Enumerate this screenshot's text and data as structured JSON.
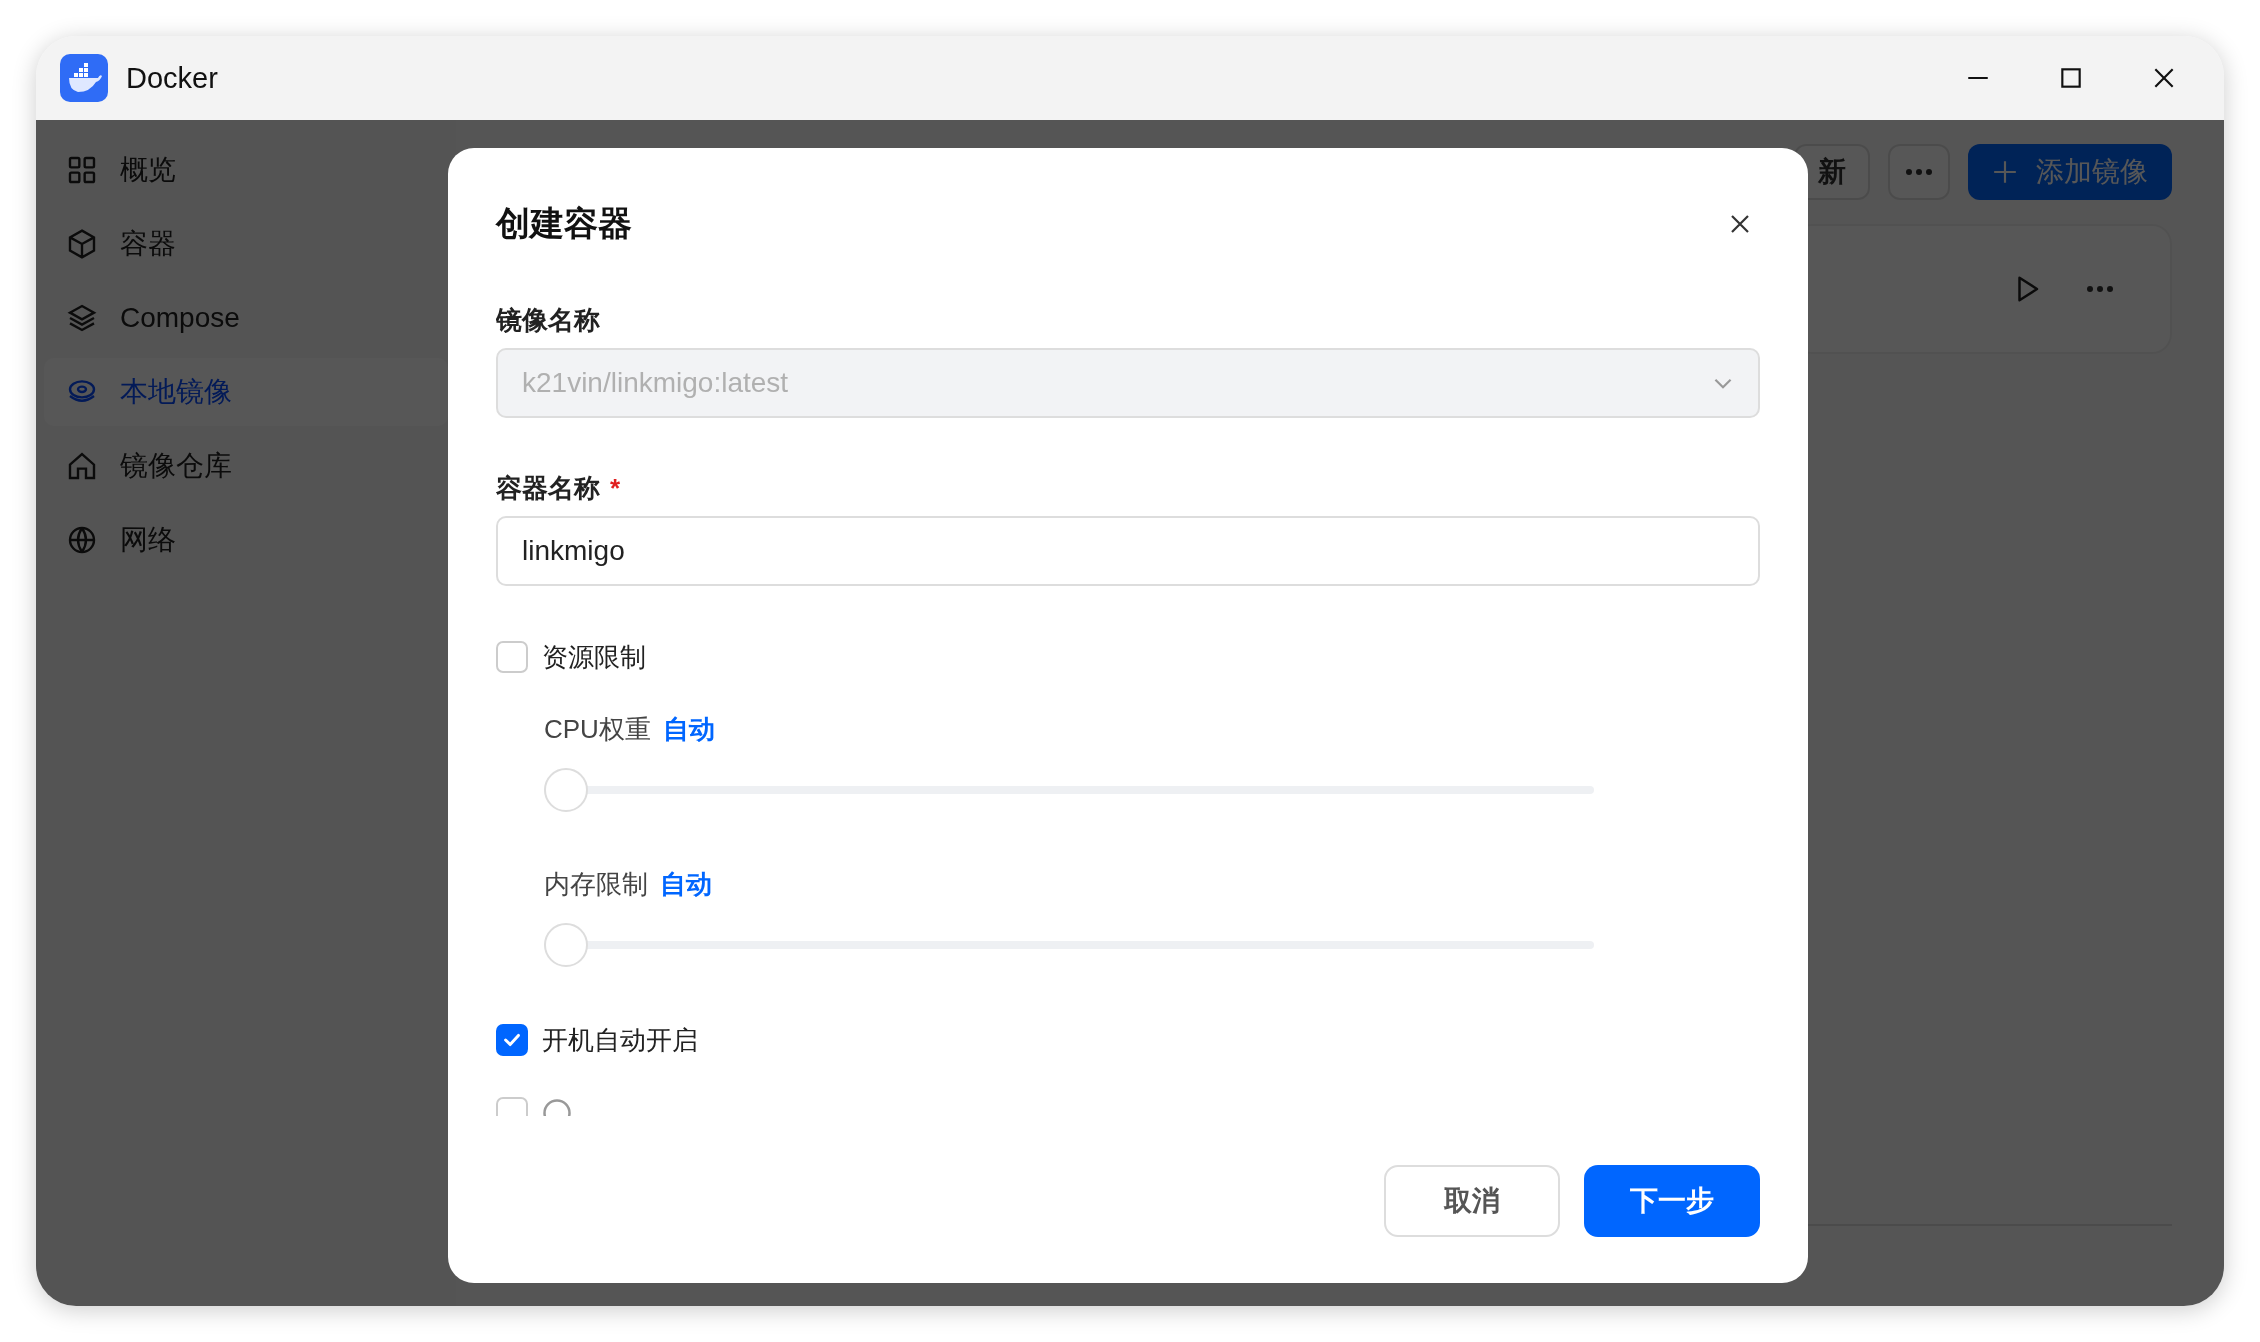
{
  "window": {
    "title": "Docker"
  },
  "sidebar": {
    "items": [
      {
        "label": "概览",
        "selected": false
      },
      {
        "label": "容器",
        "selected": false
      },
      {
        "label": "Compose",
        "selected": false
      },
      {
        "label": "本地镜像",
        "selected": true
      },
      {
        "label": "镜像仓库",
        "selected": false
      },
      {
        "label": "网络",
        "selected": false
      }
    ]
  },
  "toolbar": {
    "refresh_label": "新",
    "add_label": "添加镜像"
  },
  "dialog": {
    "title": "创建容器",
    "image_field": {
      "label": "镜像名称",
      "value": "k21vin/linkmigo:latest",
      "disabled": true
    },
    "name_field": {
      "label": "容器名称",
      "required_mark": "*",
      "value": "linkmigo"
    },
    "options": [
      {
        "kind": "checkbox",
        "label": "资源限制",
        "checked": false
      },
      {
        "kind": "slider",
        "label": "CPU权重",
        "value": "自动",
        "level": 0
      },
      {
        "kind": "slider",
        "label": "内存限制",
        "value": "自动",
        "level": 0
      },
      {
        "kind": "checkbox",
        "label": "开机自动开启",
        "checked": true
      },
      {
        "kind": "checkbox",
        "checked": false,
        "help": true
      }
    ],
    "buttons": [
      {
        "label": "取消",
        "kind": "secondary"
      },
      {
        "label": "下一步",
        "kind": "primary"
      }
    ]
  }
}
